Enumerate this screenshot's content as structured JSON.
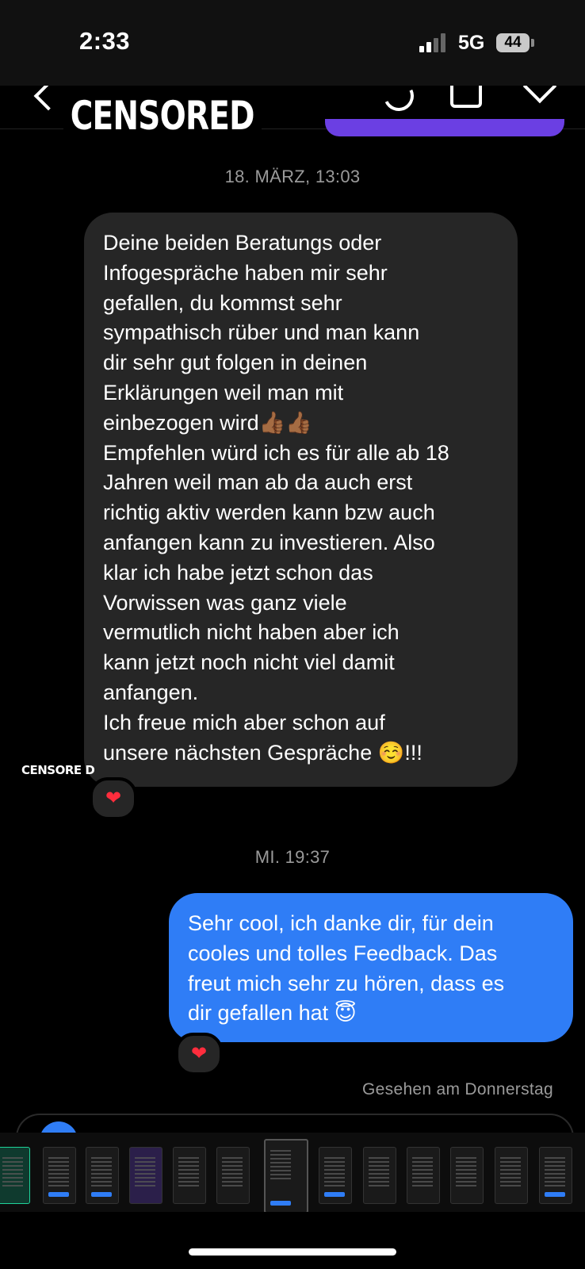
{
  "status_bar": {
    "time": "2:33",
    "network": "5G",
    "battery": "44"
  },
  "header": {
    "censored_label": "CENSORED",
    "accent_color": "#6b3fe3",
    "icons": [
      "back-icon",
      "call-icon",
      "video-icon",
      "info-icon"
    ]
  },
  "conversation": {
    "date_1": "18. MÄRZ, 13:03",
    "incoming_message": "Deine beiden Beratungs oder\nInfogespräche haben mir sehr\ngefallen, du kommst sehr\nsympathisch rüber und man kann\ndir sehr gut folgen in deinen\nErklärungen weil man mit\neinbezogen wird👍🏾👍🏾\nEmpfehlen würd ich es für alle ab 18\nJahren weil man ab da auch erst\nrichtig aktiv werden kann bzw auch\nanfangen kann zu investieren. Also\nklar ich habe jetzt schon das\nVorwissen was ganz viele\nvermutlich nicht haben aber ich\nkann jetzt noch nicht viel damit\nanfangen.\nIch freue mich aber schon auf\nunsere nächsten Gespräche ☺️!!!",
    "incoming_avatar_label": "CENSORE D",
    "reaction_1": "❤",
    "date_2": "MI. 19:37",
    "outgoing_message": "Sehr cool, ich danke dir, für dein\ncooles und tolles Feedback. Das\nfreut mich sehr zu hören, dass es\ndir gefallen hat 😇",
    "reaction_2": "❤",
    "seen_status": "Gesehen am Donnerstag",
    "outgoing_color": "#2f7df6",
    "incoming_color": "#262626"
  }
}
